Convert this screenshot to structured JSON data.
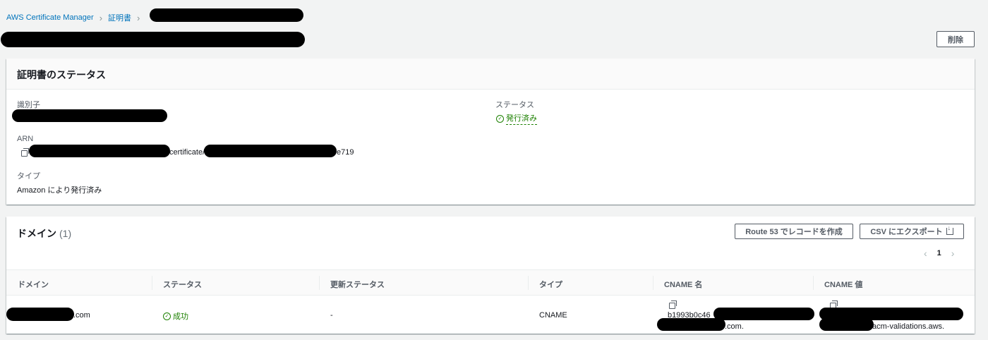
{
  "breadcrumb": {
    "root": "AWS Certificate Manager",
    "certificates": "証明書"
  },
  "header": {
    "delete_label": "削除"
  },
  "status_panel": {
    "title": "証明書のステータス",
    "identifier_label": "識別子",
    "arn_label": "ARN",
    "arn_mid": "certificate/",
    "arn_suffix": "e719",
    "type_label": "タイプ",
    "type_value": "Amazon により発行済み",
    "status_label": "ステータス",
    "status_value": "発行済み"
  },
  "domain_panel": {
    "title": "ドメイン",
    "count": "(1)",
    "route53_button": "Route 53 でレコードを作成",
    "csv_button": "CSV にエクスポート",
    "page": "1",
    "columns": [
      "ドメイン",
      "ステータス",
      "更新ステータス",
      "タイプ",
      "CNAME 名",
      "CNAME 値"
    ],
    "rows": [
      {
        "domain_suffix": ".com",
        "status": "成功",
        "renewal_status": "-",
        "type": "CNAME",
        "cname_name_prefix": "b1993b0c46",
        "cname_name_suffix": ".com.",
        "cname_value_suffix": "acm-validations.aws."
      }
    ]
  },
  "colors": {
    "link": "#0073bb",
    "success": "#1d8102",
    "background": "#f2f3f3"
  }
}
